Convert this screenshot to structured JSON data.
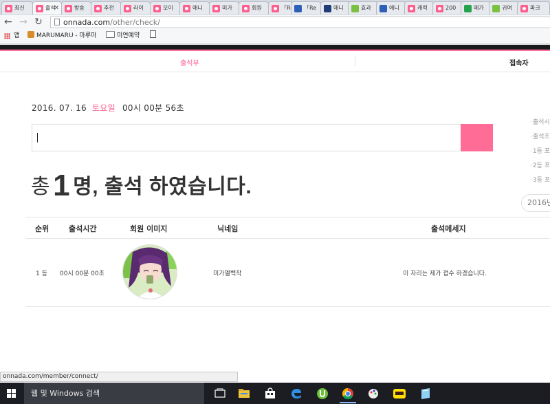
{
  "browser": {
    "tabs": [
      {
        "label": "최신"
      },
      {
        "label": "출석"
      },
      {
        "label": "방송"
      },
      {
        "label": "추천"
      },
      {
        "label": "라이"
      },
      {
        "label": "모이"
      },
      {
        "label": "애니"
      },
      {
        "label": "미가"
      },
      {
        "label": "회원"
      },
      {
        "label": "「Re"
      },
      {
        "label": "「Re"
      },
      {
        "label": "애니"
      },
      {
        "label": "효과"
      },
      {
        "label": "애니"
      },
      {
        "label": "캐릭"
      },
      {
        "label": "200"
      },
      {
        "label": "메가"
      },
      {
        "label": "귀여"
      },
      {
        "label": "파크"
      }
    ],
    "url_host": "onnada.com",
    "url_path": "/other/check/",
    "bookmarks": [
      {
        "label": "앱"
      },
      {
        "label": "MARUMARU - 마루마"
      },
      {
        "label": "미연예약"
      }
    ]
  },
  "site": {
    "nav": {
      "attendance": "출석부",
      "connected": "접속자"
    },
    "date": {
      "date": "2016. 07. 16",
      "day_of_week": "토요일",
      "time": "00시 00분 56초"
    },
    "side_links": [
      "출석시",
      "출석조",
      "1등 포",
      "2등 포",
      "3등 포"
    ],
    "year_pill": "2016년",
    "headline": {
      "prefix": "총",
      "count": "1",
      "suffix": "명, 출석 하였습니다."
    },
    "table": {
      "headers": {
        "rank": "순위",
        "time": "출석시간",
        "image": "회원 이미지",
        "nickname": "닉네임",
        "message": "출석메세지"
      },
      "rows": [
        {
          "rank": "1 등",
          "time": "00시 00분 00초",
          "nickname": "미가엘백작",
          "message": "이 자리는 제가 접수 하겠습니다."
        }
      ]
    }
  },
  "status_url": "onnada.com/member/connect/",
  "taskbar": {
    "search_placeholder": "웹 및 Windows 검색"
  },
  "colors": {
    "accent": "#ff6d96",
    "nav_active": "#ff5f8f",
    "topbar": "#1a1a1a",
    "taskbar": "#1b1d22"
  }
}
